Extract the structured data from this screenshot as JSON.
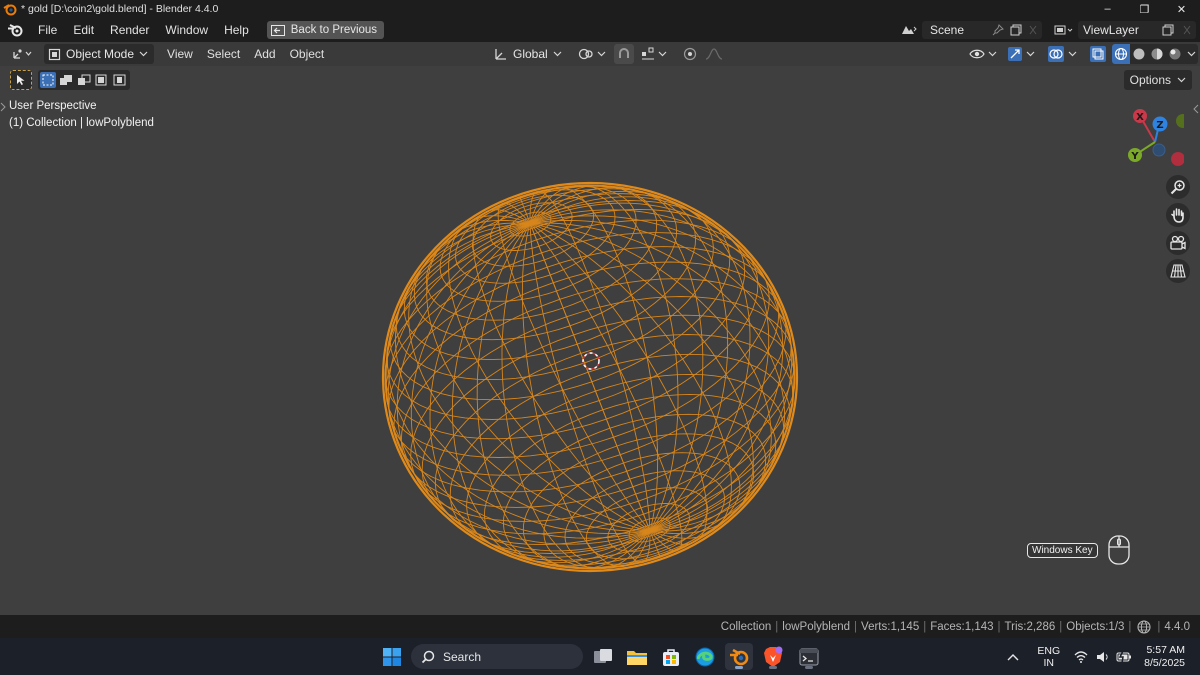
{
  "window": {
    "title": "* gold [D:\\coin2\\gold.blend] - Blender 4.4.0",
    "minimize_glyph": "–",
    "restore_glyph": "❐",
    "close_glyph": "✕"
  },
  "menubar": {
    "items": [
      "File",
      "Edit",
      "Render",
      "Window",
      "Help"
    ],
    "back_button": "Back to Previous",
    "scene_name": "Scene",
    "view_layer": "ViewLayer"
  },
  "viewport_header": {
    "mode": "Object Mode",
    "menus": [
      "View",
      "Select",
      "Add",
      "Object"
    ],
    "transform_orientation": "Global"
  },
  "toolbar": {
    "options_label": "Options"
  },
  "overlay": {
    "perspective": "User Perspective",
    "collection_line": "(1) Collection | lowPolyblend"
  },
  "gizmo": {
    "x": "X",
    "y": "Y",
    "z": "Z",
    "colors": {
      "x": "#c9394a",
      "y": "#7ba928",
      "z": "#2f83e0"
    }
  },
  "screencast": {
    "key_label": "Windows Key"
  },
  "statusbar": {
    "collection": "Collection",
    "object": "lowPolyblend",
    "verts": "Verts:1,145",
    "faces": "Faces:1,143",
    "tris": "Tris:2,286",
    "objects": "Objects:1/3",
    "version": "4.4.0"
  },
  "taskbar": {
    "search_placeholder": "Search",
    "lang_top": "ENG",
    "lang_bottom": "IN",
    "time": "5:57 AM",
    "date": "8/5/2025"
  },
  "colors": {
    "wire": "#e08a1a",
    "viewport_bg": "#3f3f3f"
  }
}
